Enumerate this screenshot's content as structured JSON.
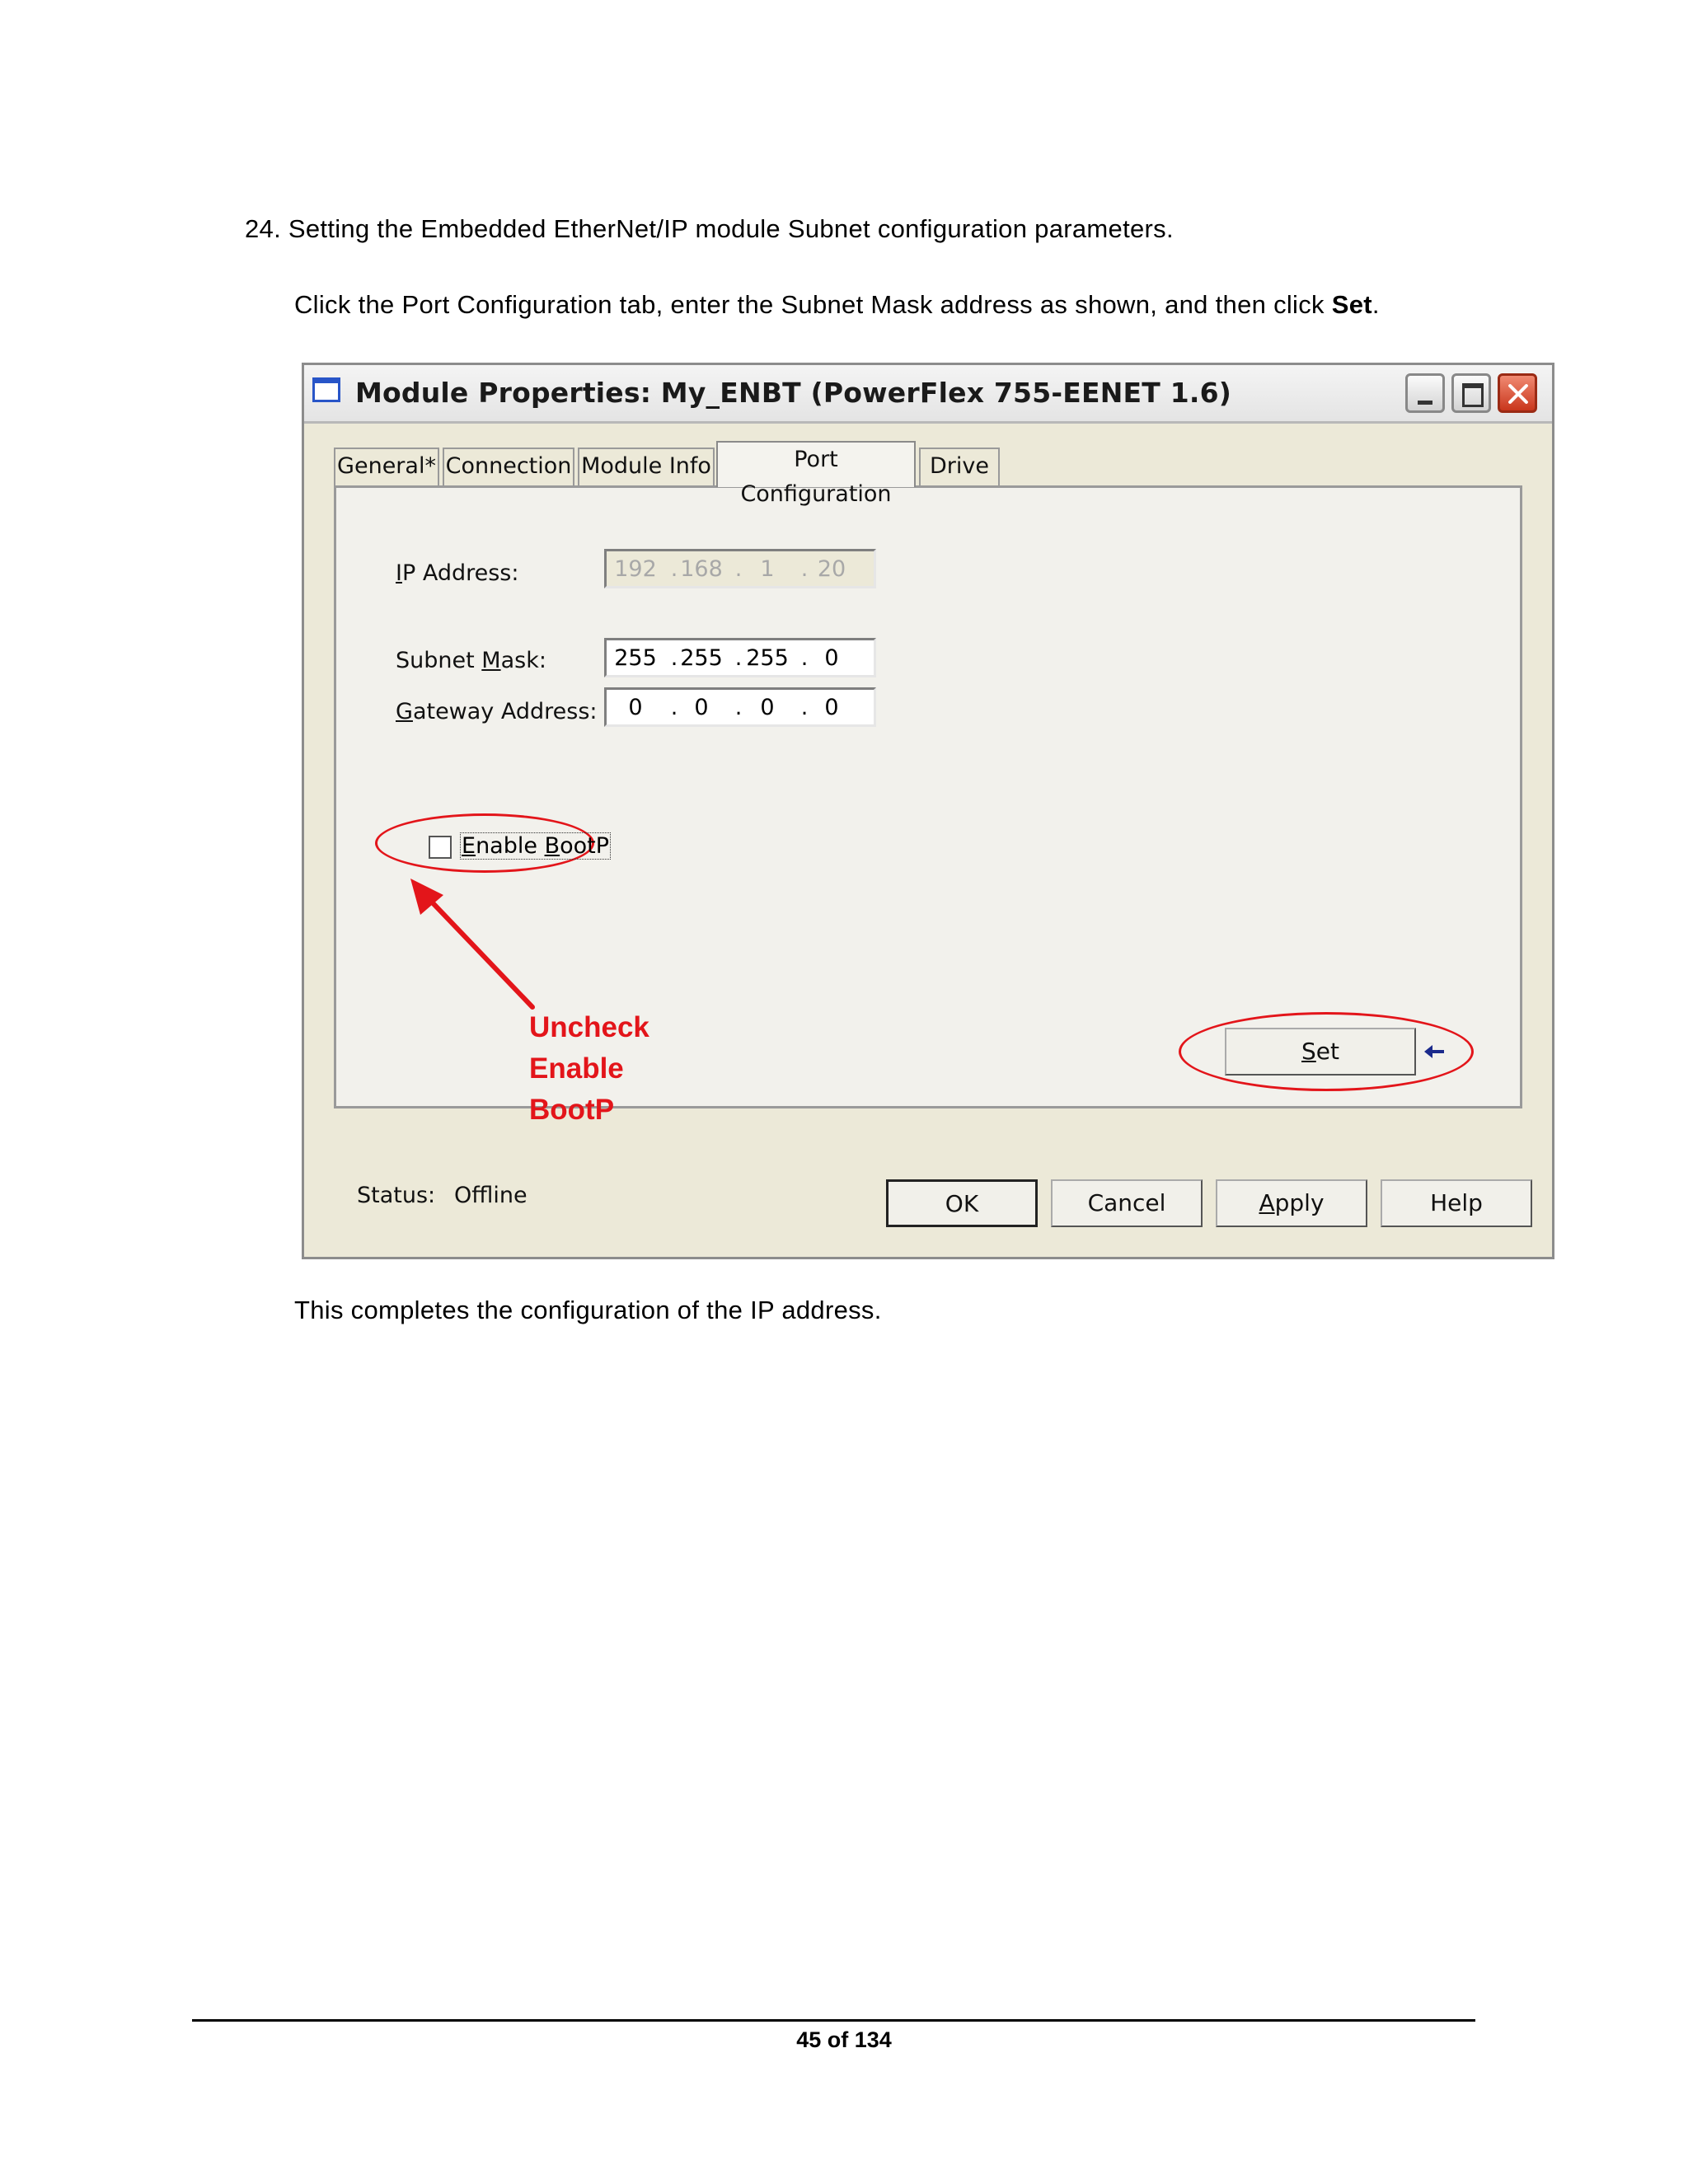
{
  "doc": {
    "step_line": "24. Setting the Embedded  EtherNet/IP  module  Subnet  configuration  parameters.",
    "instruction_pre": "Click the Port Configuration  tab, enter the Subnet Mask address as shown, and then click ",
    "instruction_bold": "Set",
    "instruction_post": ".",
    "closing": "This  completes the  configuration  of the IP address.",
    "footer": "45 of 134"
  },
  "window": {
    "title": "Module Properties: My_ENBT (PowerFlex 755-EENET 1.6)"
  },
  "tabs": [
    {
      "label": "General*"
    },
    {
      "label": "Connection"
    },
    {
      "label": "Module Info"
    },
    {
      "label": "Port Configuration",
      "active": true
    },
    {
      "label": "Drive"
    }
  ],
  "port_config": {
    "ip_label": {
      "u": "I",
      "rest": "P Address:"
    },
    "ip": [
      "192",
      "168",
      "1",
      "20"
    ],
    "subnet_label": {
      "pre": "Subnet ",
      "u": "M",
      "rest": "ask:"
    },
    "subnet": [
      "255",
      "255",
      "255",
      "0"
    ],
    "gateway_label": {
      "u": "G",
      "rest": "ateway Address:"
    },
    "gateway": [
      "0",
      "0",
      "0",
      "0"
    ],
    "bootp_label": {
      "u1": "E",
      "mid": "nable ",
      "u2": "B",
      "rest": "ootP"
    },
    "bootp_checked": false,
    "set_button": {
      "u": "S",
      "rest": "et"
    }
  },
  "annotation": {
    "lines": [
      "Uncheck",
      "Enable",
      "BootP"
    ],
    "color": "#e3151a"
  },
  "footer_bar": {
    "status_label": "Status:",
    "status_value": "Offline",
    "ok": "OK",
    "cancel": "Cancel",
    "apply": {
      "u": "A",
      "rest": "pply"
    },
    "help": "Help"
  }
}
